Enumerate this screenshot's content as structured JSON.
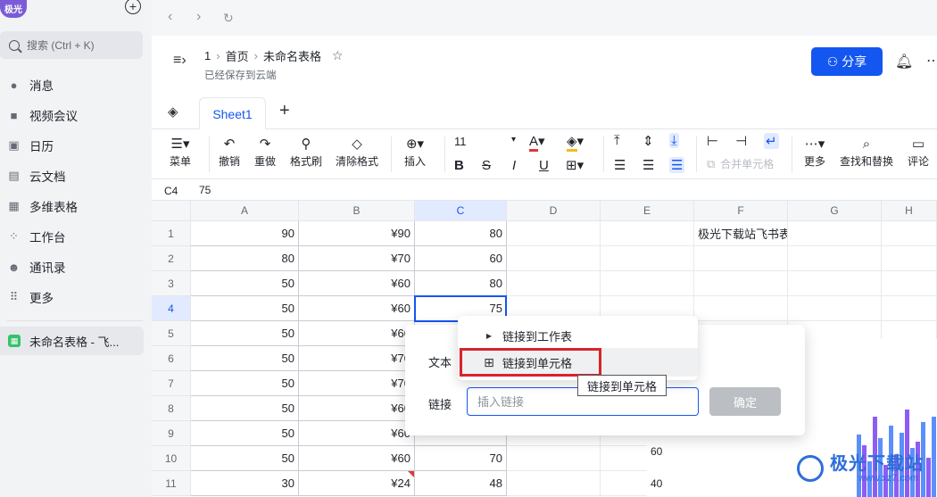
{
  "sidebar": {
    "avatar": "极光",
    "search_placeholder": "搜索 (Ctrl + K)",
    "items": [
      {
        "label": "消息",
        "icon": "chat-icon"
      },
      {
        "label": "视频会议",
        "icon": "video-icon"
      },
      {
        "label": "日历",
        "icon": "calendar-icon"
      },
      {
        "label": "云文档",
        "icon": "document-icon"
      },
      {
        "label": "多维表格",
        "icon": "table-icon"
      },
      {
        "label": "工作台",
        "icon": "apps-icon"
      },
      {
        "label": "通讯录",
        "icon": "contacts-icon"
      },
      {
        "label": "更多",
        "icon": "grid-dots-icon"
      }
    ],
    "open_doc": "未命名表格 - 飞..."
  },
  "header": {
    "breadcrumb": [
      "1",
      "首页",
      "未命名表格"
    ],
    "saved_status": "已经保存到云端",
    "share_label": "分享"
  },
  "tabs": {
    "sheet_name": "Sheet1"
  },
  "toolbar": {
    "menu": "菜单",
    "undo": "撤销",
    "redo": "重做",
    "format_painter": "格式刷",
    "clear_format": "清除格式",
    "insert": "插入",
    "font_size": "11",
    "merge_cells": "合并单元格",
    "more": "更多",
    "find_replace": "查找和替换",
    "comment": "评论"
  },
  "formula_bar": {
    "cell_ref": "C4",
    "value": "75"
  },
  "columns": [
    "A",
    "B",
    "C",
    "D",
    "E",
    "F",
    "G",
    "H"
  ],
  "rows": [
    {
      "n": "1",
      "a": "90",
      "b": "¥90",
      "c": "80",
      "f": "极光下载站飞书表"
    },
    {
      "n": "2",
      "a": "80",
      "b": "¥70",
      "c": "60",
      "f": ""
    },
    {
      "n": "3",
      "a": "50",
      "b": "¥60",
      "c": "80",
      "f": ""
    },
    {
      "n": "4",
      "a": "50",
      "b": "¥60",
      "c": "75",
      "f": ""
    },
    {
      "n": "5",
      "a": "50",
      "b": "¥60",
      "c": "",
      "f": ""
    },
    {
      "n": "6",
      "a": "50",
      "b": "¥70",
      "c": "",
      "f": ""
    },
    {
      "n": "7",
      "a": "50",
      "b": "¥70",
      "c": "",
      "f": ""
    },
    {
      "n": "8",
      "a": "50",
      "b": "¥60",
      "c": "",
      "f": ""
    },
    {
      "n": "9",
      "a": "50",
      "b": "¥60",
      "c": "",
      "f": ""
    },
    {
      "n": "10",
      "a": "50",
      "b": "¥60",
      "c": "70",
      "f": ""
    },
    {
      "n": "11",
      "a": "30",
      "b": "¥24",
      "c": "48",
      "f": ""
    }
  ],
  "chart": {
    "ticks": [
      "60",
      "40"
    ]
  },
  "link_dialog": {
    "text_label": "文本",
    "link_label": "链接",
    "link_placeholder": "插入链接",
    "confirm": "确定"
  },
  "link_menu": {
    "to_sheet": "链接到工作表",
    "to_cell": "链接到单元格",
    "tooltip": "链接到单元格"
  },
  "watermark": {
    "text": "极光下载站",
    "url": "www.xz7.com"
  },
  "colors": {
    "accent": "#1456f0",
    "sidebar_bg": "#f2f3f5",
    "highlight_red": "#d9232a",
    "bar_blue": "#5b8ff9",
    "bar_purple": "#8e5cf5"
  }
}
